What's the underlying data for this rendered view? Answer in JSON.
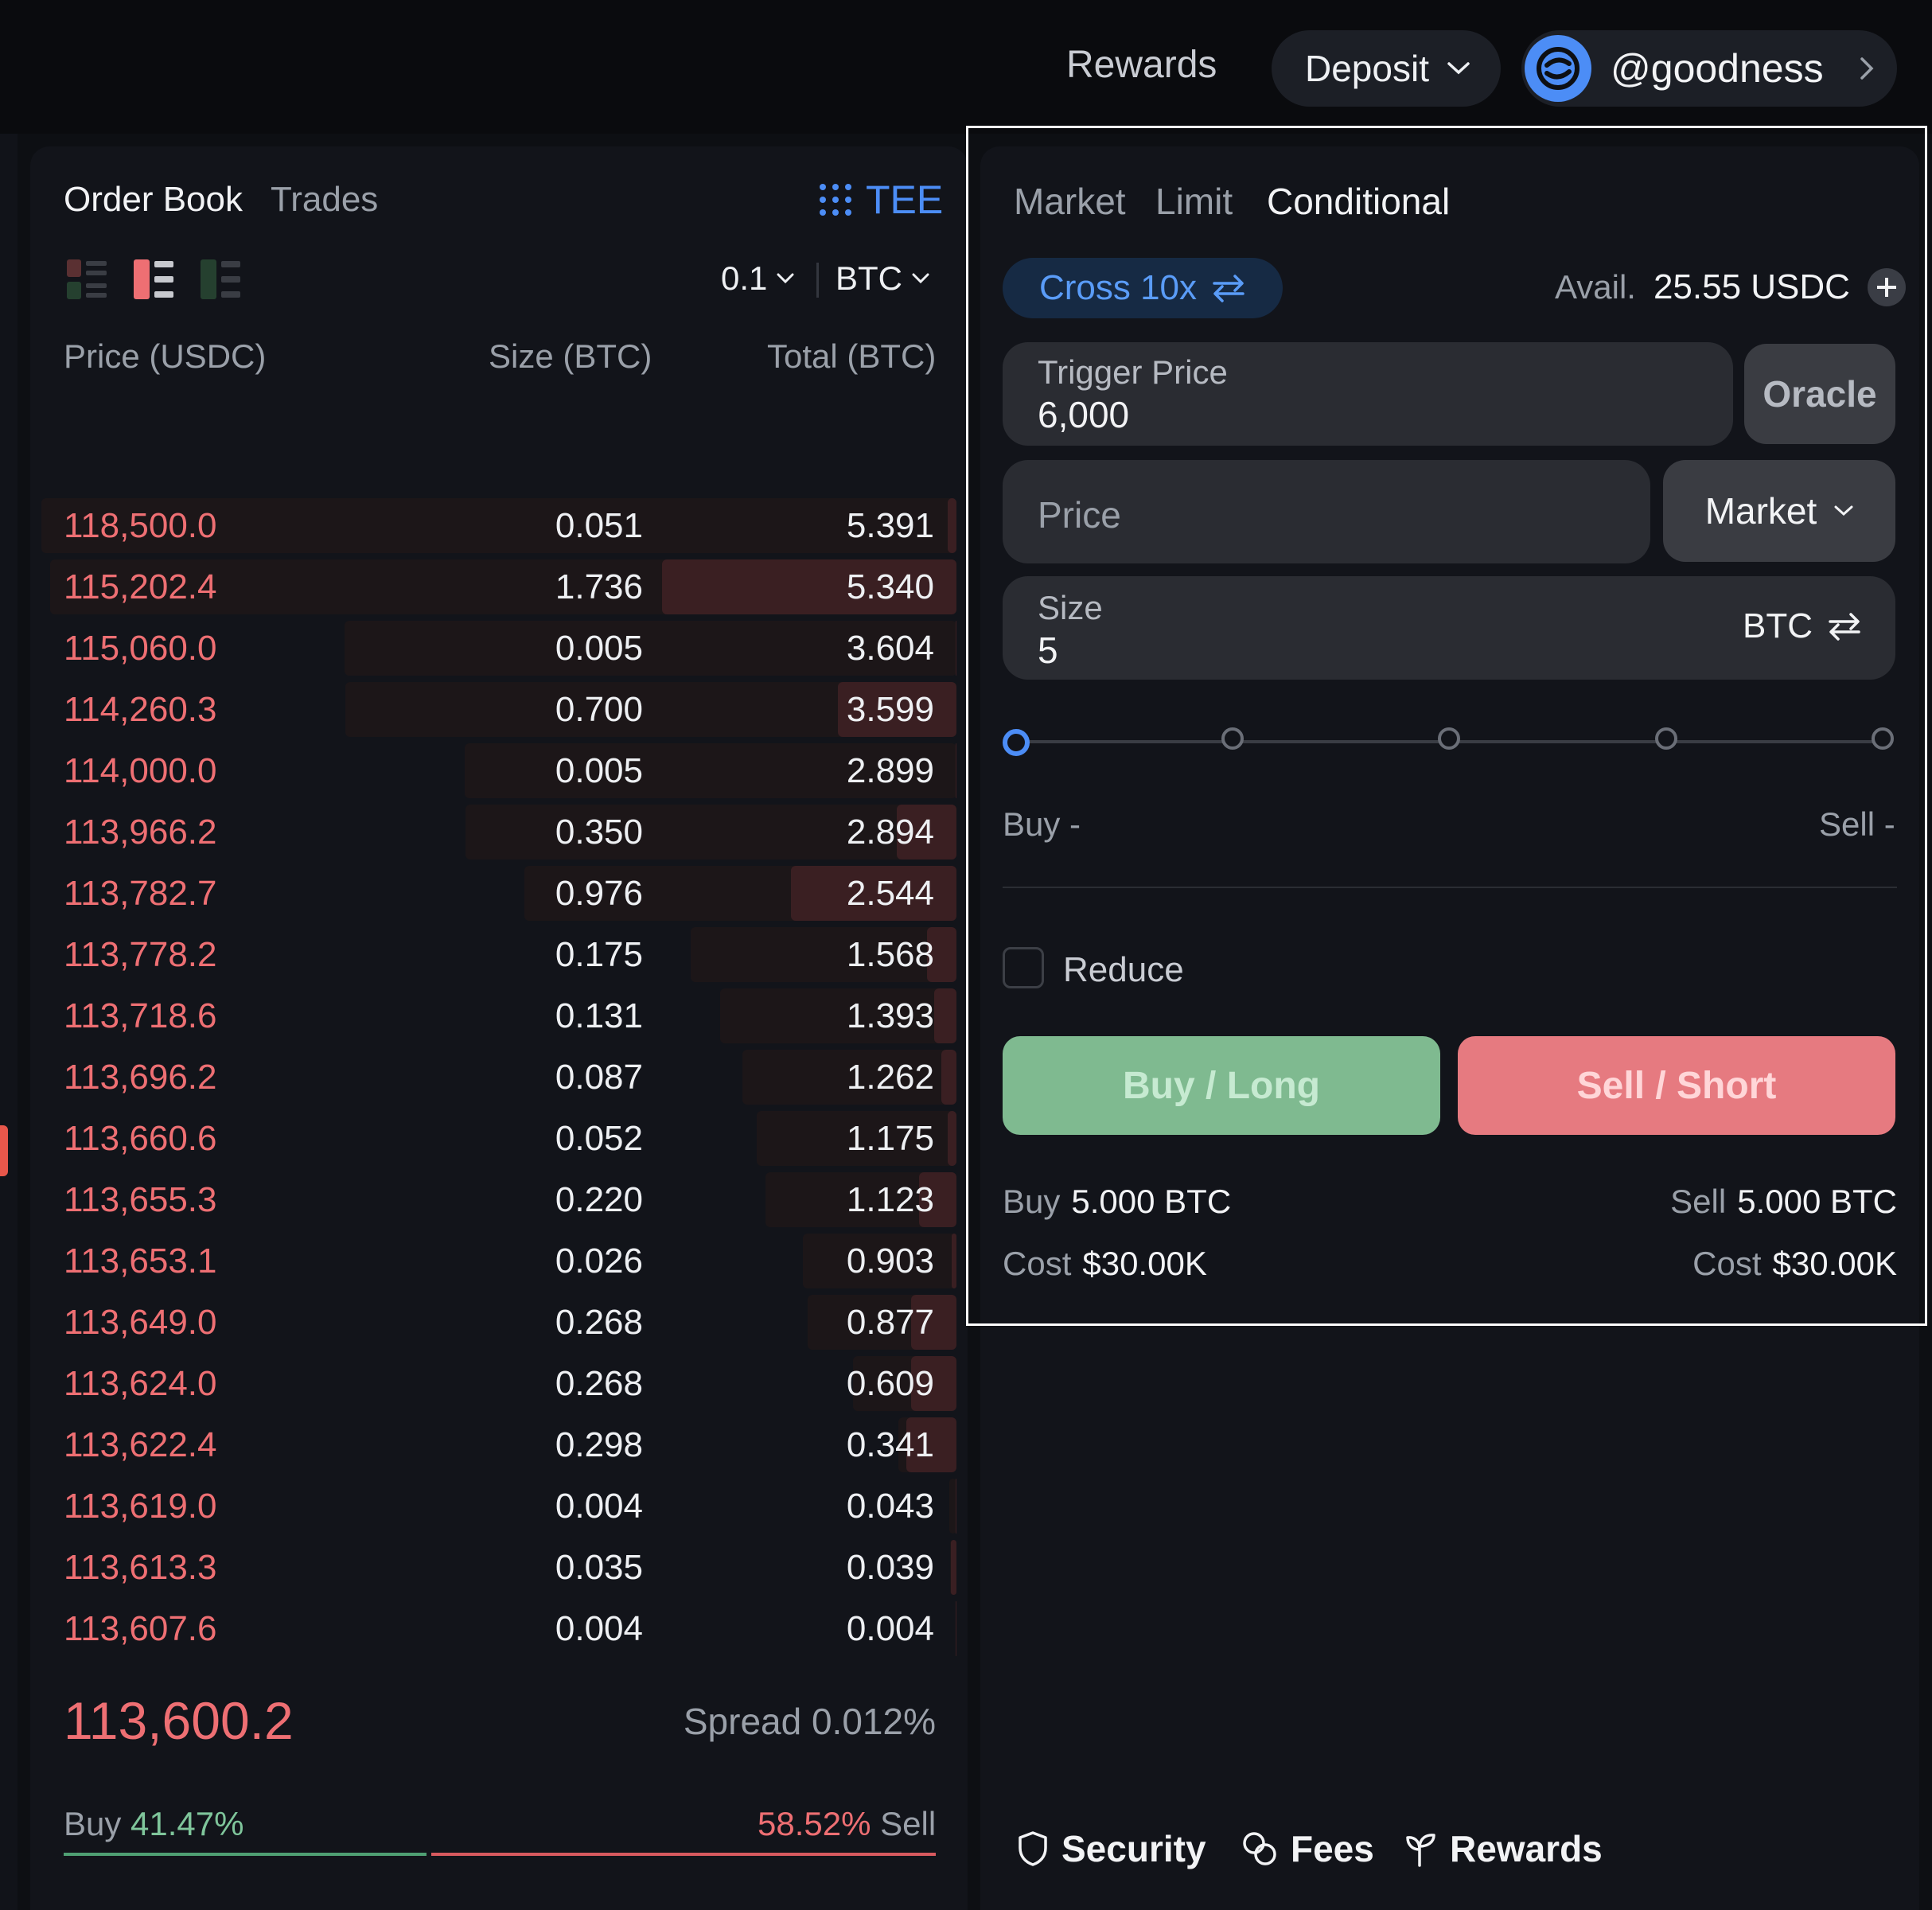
{
  "header": {
    "rewards_label": "Rewards",
    "deposit_label": "Deposit",
    "username": "@goodness"
  },
  "order_book": {
    "tabs": [
      "Order Book",
      "Trades"
    ],
    "active_tab": "Order Book",
    "tee_label": "TEE",
    "tick_size": "0.1",
    "unit": "BTC",
    "columns": [
      "Price (USDC)",
      "Size (BTC)",
      "Total (BTC)"
    ],
    "asks": [
      {
        "price": "118,500.0",
        "size": "0.051",
        "total": "5.391"
      },
      {
        "price": "115,202.4",
        "size": "1.736",
        "total": "5.340"
      },
      {
        "price": "115,060.0",
        "size": "0.005",
        "total": "3.604"
      },
      {
        "price": "114,260.3",
        "size": "0.700",
        "total": "3.599"
      },
      {
        "price": "114,000.0",
        "size": "0.005",
        "total": "2.899"
      },
      {
        "price": "113,966.2",
        "size": "0.350",
        "total": "2.894"
      },
      {
        "price": "113,782.7",
        "size": "0.976",
        "total": "2.544"
      },
      {
        "price": "113,778.2",
        "size": "0.175",
        "total": "1.568"
      },
      {
        "price": "113,718.6",
        "size": "0.131",
        "total": "1.393"
      },
      {
        "price": "113,696.2",
        "size": "0.087",
        "total": "1.262"
      },
      {
        "price": "113,660.6",
        "size": "0.052",
        "total": "1.175"
      },
      {
        "price": "113,655.3",
        "size": "0.220",
        "total": "1.123"
      },
      {
        "price": "113,653.1",
        "size": "0.026",
        "total": "0.903"
      },
      {
        "price": "113,649.0",
        "size": "0.268",
        "total": "0.877"
      },
      {
        "price": "113,624.0",
        "size": "0.268",
        "total": "0.609"
      },
      {
        "price": "113,622.4",
        "size": "0.298",
        "total": "0.341"
      },
      {
        "price": "113,619.0",
        "size": "0.004",
        "total": "0.043"
      },
      {
        "price": "113,613.3",
        "size": "0.035",
        "total": "0.039"
      },
      {
        "price": "113,607.6",
        "size": "0.004",
        "total": "0.004"
      }
    ],
    "mid_price": "113,600.2",
    "spread": "Spread 0.012%",
    "buy_label": "Buy",
    "buy_pct": "41.47%",
    "sell_label": "Sell",
    "sell_pct": "58.52%"
  },
  "order_form": {
    "tabs": [
      "Market",
      "Limit",
      "Conditional"
    ],
    "active_tab": "Conditional",
    "margin_mode": "Cross 10x",
    "avail_label": "Avail.",
    "avail_value": "25.55 USDC",
    "trigger_price_label": "Trigger Price",
    "trigger_price_value": "6,000",
    "oracle_label": "Oracle",
    "price_placeholder": "Price",
    "order_type": "Market",
    "size_label": "Size",
    "size_value": "5",
    "size_unit": "BTC",
    "slider_percent": 0,
    "buy_estimate": "Buy -",
    "sell_estimate": "Sell -",
    "reduce_label": "Reduce",
    "reduce_checked": false,
    "buy_button": "Buy / Long",
    "sell_button": "Sell / Short",
    "summary": {
      "buy_label": "Buy",
      "buy_value": "5.000 BTC",
      "sell_label": "Sell",
      "sell_value": "5.000 BTC",
      "cost_label": "Cost",
      "buy_cost": "$30.00K",
      "sell_cost": "$30.00K"
    }
  },
  "footer": {
    "security": "Security",
    "fees": "Fees",
    "rewards": "Rewards"
  },
  "colors": {
    "ask_red": "#ee6f73",
    "buy_green": "#7fba90",
    "sell_red": "#e67a80",
    "accent_blue": "#4c8df6"
  }
}
